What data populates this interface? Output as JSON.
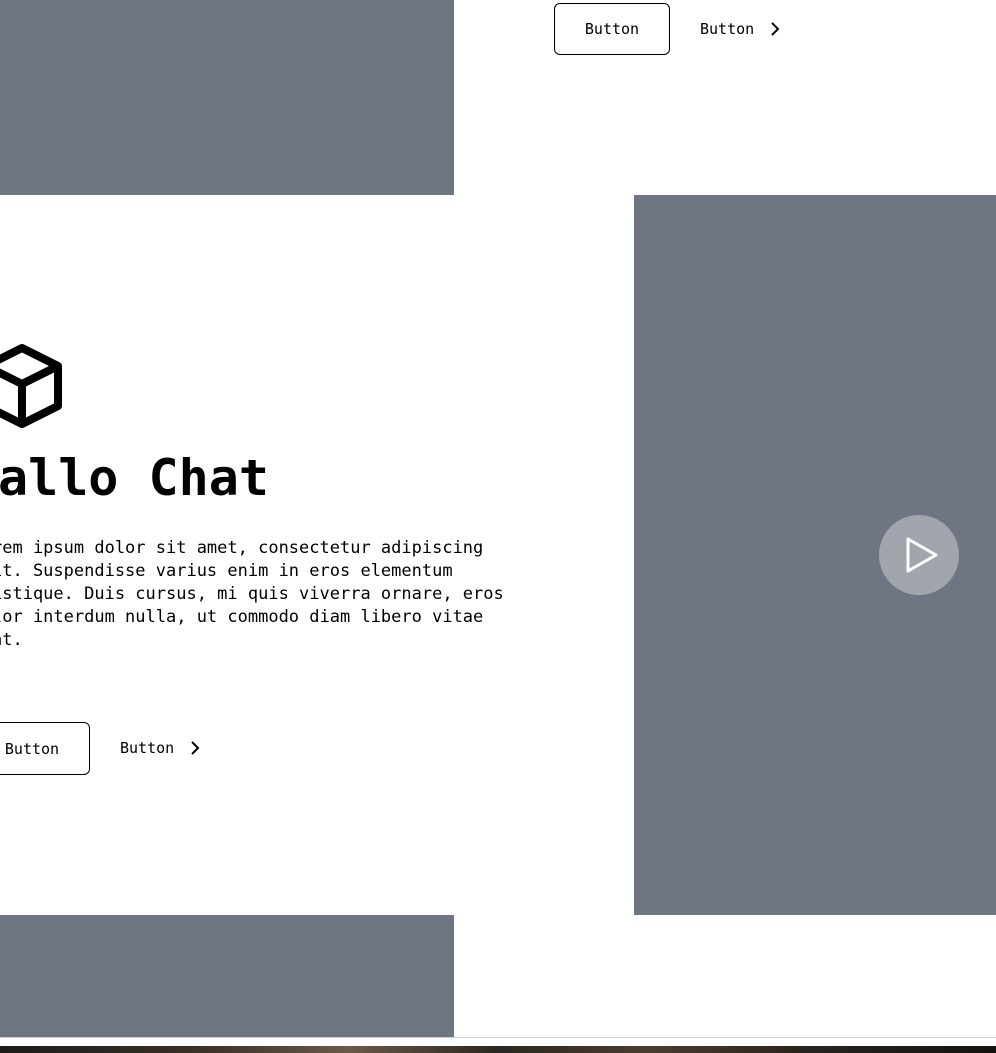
{
  "top_section": {
    "primary_button": "Button",
    "secondary_button": "Button"
  },
  "hero": {
    "icon": "cube-icon",
    "title": "allo Chat",
    "body": "rem ipsum dolor sit amet, consectetur adipiscing\nit. Suspendisse varius enim in eros elementum\nistique. Duis cursus, mi quis viverra ornare, eros\nlor interdum nulla, ut commodo diam libero vitae\nat.",
    "primary_button": "Button",
    "secondary_button": "Button"
  },
  "media": {
    "play_icon": "play-icon",
    "placeholder_color": "#6f7582"
  }
}
